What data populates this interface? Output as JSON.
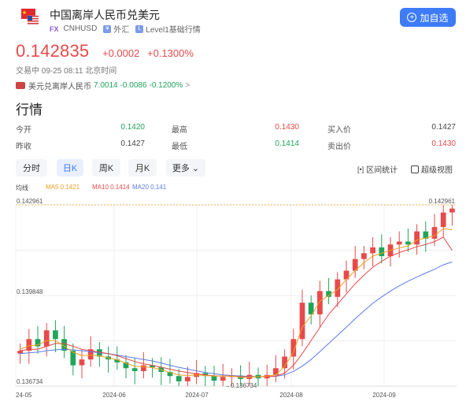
{
  "header": {
    "title": "中国离岸人民币兑美元",
    "market_badge": "FX",
    "symbol": "CNHUSD",
    "category": "外汇",
    "level": "Level1基础行情",
    "add_button": "加自选"
  },
  "quote": {
    "price": "0.142835",
    "change": "+0.0002",
    "change_pct": "+0.1300%",
    "status": "交易中 09-25 08:11 北京时间",
    "related_name": "美元兑离岸人民币",
    "related_price": "7.0014",
    "related_change": "-0.0086",
    "related_pct": "-0.1200%",
    "related_arrow": ">"
  },
  "market": {
    "section_title": "行情",
    "rows": [
      [
        {
          "label": "今开",
          "value": "0.1420",
          "color": "green"
        },
        {
          "label": "最高",
          "value": "0.1430",
          "color": "red"
        },
        {
          "label": "买入价",
          "value": "0.1427",
          "color": "dark"
        }
      ],
      [
        {
          "label": "昨收",
          "value": "0.1427",
          "color": "dark"
        },
        {
          "label": "最低",
          "value": "0.1414",
          "color": "green"
        },
        {
          "label": "卖出价",
          "value": "0.1430",
          "color": "red"
        }
      ]
    ]
  },
  "tabs": [
    {
      "label": "分时",
      "active": false
    },
    {
      "label": "日K",
      "active": true
    },
    {
      "label": "周K",
      "active": false
    },
    {
      "label": "月K",
      "active": false
    },
    {
      "label": "更多 ⌄",
      "active": false
    }
  ],
  "tools": {
    "range_stats": "区间统计",
    "super_view": "超级视图"
  },
  "legend": {
    "label": "均线",
    "ma5": "MA5 0.1421",
    "ma10": "MA10 0.1414",
    "ma20": "MA20 0.141"
  },
  "colors": {
    "up": "#e74a4a",
    "down": "#20a45a",
    "accent": "#3d7bf7",
    "ma5": "#f0a020",
    "ma10": "#e74a4a",
    "ma20": "#5b7be8"
  },
  "chart_data": {
    "type": "candlestick",
    "y_labels": [
      "0.142961",
      "0.139848",
      "0.136734"
    ],
    "ylim": [
      0.136734,
      0.142961
    ],
    "x_labels": [
      "24-05",
      "2024-06",
      "2024-07",
      "2024-08",
      "2024-09"
    ],
    "max_marker": "0.142961",
    "min_marker": "0.136734",
    "closes": [
      0.13795,
      0.13835,
      0.1381,
      0.13865,
      0.13835,
      0.13795,
      0.13745,
      0.13765,
      0.138,
      0.13775,
      0.13765,
      0.13755,
      0.13735,
      0.13725,
      0.13745,
      0.13738,
      0.13722,
      0.13708,
      0.1369,
      0.13705,
      0.13718,
      0.13708,
      0.13692,
      0.13705,
      0.1371,
      0.13698,
      0.13712,
      0.137,
      0.13712,
      0.13735,
      0.13775,
      0.13835,
      0.1396,
      0.1392,
      0.14,
      0.1398,
      0.1404,
      0.1407,
      0.1411,
      0.1413,
      0.1415,
      0.1412,
      0.1416,
      0.1417,
      0.1416,
      0.14205,
      0.1418,
      0.1422,
      0.1427,
      0.142835
    ],
    "ma5": [
      0.138,
      0.13812,
      0.13815,
      0.1383,
      0.1383,
      0.1381,
      0.1379,
      0.13778,
      0.1378,
      0.13778,
      0.1377,
      0.13764,
      0.13752,
      0.13742,
      0.1374,
      0.13737,
      0.1373,
      0.1372,
      0.13712,
      0.1371,
      0.13712,
      0.1371,
      0.13708,
      0.13708,
      0.13708,
      0.13704,
      0.13704,
      0.13706,
      0.13708,
      0.13712,
      0.13742,
      0.1379,
      0.13876,
      0.13915,
      0.13965,
      0.13985,
      0.14005,
      0.1404,
      0.1407,
      0.14098,
      0.1412,
      0.1413,
      0.1414,
      0.14148,
      0.14155,
      0.14175,
      0.14182,
      0.1419,
      0.14215,
      0.1421
    ],
    "ma10": [
      0.13795,
      0.138,
      0.138,
      0.1381,
      0.1382,
      0.1382,
      0.1381,
      0.138,
      0.13795,
      0.1379,
      0.13785,
      0.13778,
      0.13768,
      0.13758,
      0.1375,
      0.13745,
      0.13738,
      0.13732,
      0.13725,
      0.1372,
      0.13716,
      0.13712,
      0.13709,
      0.13708,
      0.13708,
      0.13706,
      0.13706,
      0.13706,
      0.13706,
      0.13708,
      0.13718,
      0.13745,
      0.13785,
      0.1383,
      0.13875,
      0.1392,
      0.13955,
      0.1399,
      0.14025,
      0.14055,
      0.14082,
      0.14102,
      0.1412,
      0.14132,
      0.14142,
      0.14152,
      0.1416,
      0.1417,
      0.14185,
      0.1414
    ],
    "ma20": [
      0.13785,
      0.13788,
      0.1379,
      0.13795,
      0.13798,
      0.138,
      0.13798,
      0.13795,
      0.13792,
      0.13788,
      0.13785,
      0.1378,
      0.13775,
      0.1377,
      0.13765,
      0.1376,
      0.13753,
      0.13745,
      0.13738,
      0.13732,
      0.13726,
      0.1372,
      0.13716,
      0.13712,
      0.1371,
      0.13708,
      0.13707,
      0.13706,
      0.13706,
      0.13707,
      0.13712,
      0.13724,
      0.13742,
      0.13765,
      0.13792,
      0.1382,
      0.13848,
      0.13876,
      0.13905,
      0.13932,
      0.13958,
      0.1398,
      0.14,
      0.14018,
      0.14034,
      0.14048,
      0.14062,
      0.14075,
      0.1409,
      0.141
    ]
  }
}
